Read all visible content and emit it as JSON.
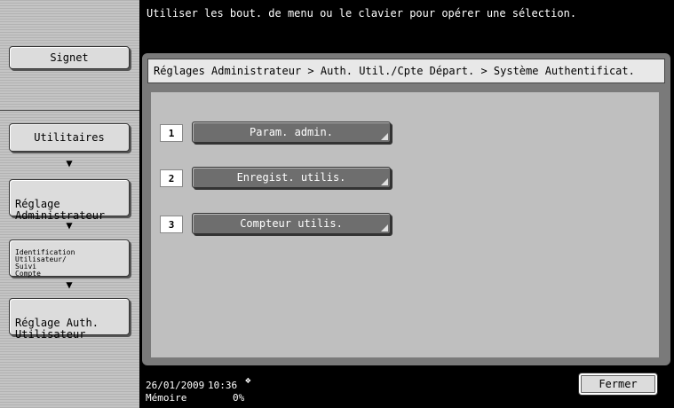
{
  "sidebar": {
    "bookmark_label": "Signet",
    "steps": [
      {
        "label": "Utilitaires"
      },
      {
        "label": "Réglage\nAdministrateur"
      },
      {
        "label": "Identification\nUtilisateur/\nSuivi\nCompte"
      },
      {
        "label": "Réglage Auth.\nUtilisateur"
      }
    ],
    "arrow_icon": "down-arrow-icon"
  },
  "header": {
    "message": "Utiliser les bout. de menu ou le clavier pour opérer une sélection."
  },
  "breadcrumb": "Réglages Administrateur > Auth. Util./Cpte Départ. > Système Authentificat.",
  "menu": {
    "items": [
      {
        "num": "1",
        "label": "Param. admin."
      },
      {
        "num": "2",
        "label": "Enregist. utilis."
      },
      {
        "num": "3",
        "label": "Compteur utilis."
      }
    ]
  },
  "status": {
    "date": "26/01/2009",
    "time": "10:36",
    "memory_label": "Mémoire",
    "memory_value": "0%",
    "network_icon": "network-icon"
  },
  "footer": {
    "close_label": "Fermer"
  }
}
